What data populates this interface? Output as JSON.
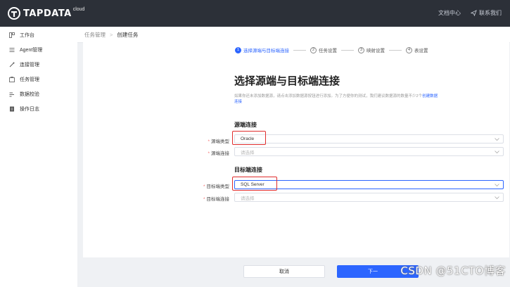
{
  "header": {
    "logo_text": "TAPDATA",
    "logo_sup": "cloud",
    "doc_center": "文档中心",
    "contact_us": "联系我们"
  },
  "sidebar": {
    "items": [
      {
        "icon": "dashboard-icon",
        "label": "工作台"
      },
      {
        "icon": "agent-icon",
        "label": "Agent管理"
      },
      {
        "icon": "connection-icon",
        "label": "连接管理"
      },
      {
        "icon": "task-icon",
        "label": "任务管理"
      },
      {
        "icon": "verify-icon",
        "label": "数据校验"
      },
      {
        "icon": "log-icon",
        "label": "操作日志"
      }
    ]
  },
  "breadcrumb": {
    "parent": "任务管理",
    "current": "创建任务"
  },
  "steps": [
    {
      "num": "1",
      "label": "选择源端与目标端连接",
      "active": true
    },
    {
      "num": "2",
      "label": "任务设置",
      "active": false
    },
    {
      "num": "3",
      "label": "映射设置",
      "active": false
    },
    {
      "num": "4",
      "label": "表设置",
      "active": false
    }
  ],
  "main": {
    "title": "选择源端与目标端连接",
    "desc": "如果你还未添加数据源，请点击添加数据源按钮进行添加。为了方便你的测试，我们建议数据源的数量不少2个",
    "desc_link": "创建数据连接",
    "source_section": "源端连接",
    "source_type_label": "源端类型",
    "source_type_value": "Oracle",
    "source_conn_label": "源端连接",
    "source_conn_placeholder": "请选择",
    "target_section": "目标端连接",
    "target_type_label": "目标端类型",
    "target_type_value": "SQL Server",
    "target_conn_label": "目标端连接",
    "target_conn_placeholder": "请选择"
  },
  "footer": {
    "cancel": "取消",
    "next": "下一"
  },
  "watermark": "CSDN @51CTO博客",
  "colors": {
    "topbar": "#2c3038",
    "accent": "#2c65ff",
    "highlight": "#e02d2d"
  }
}
